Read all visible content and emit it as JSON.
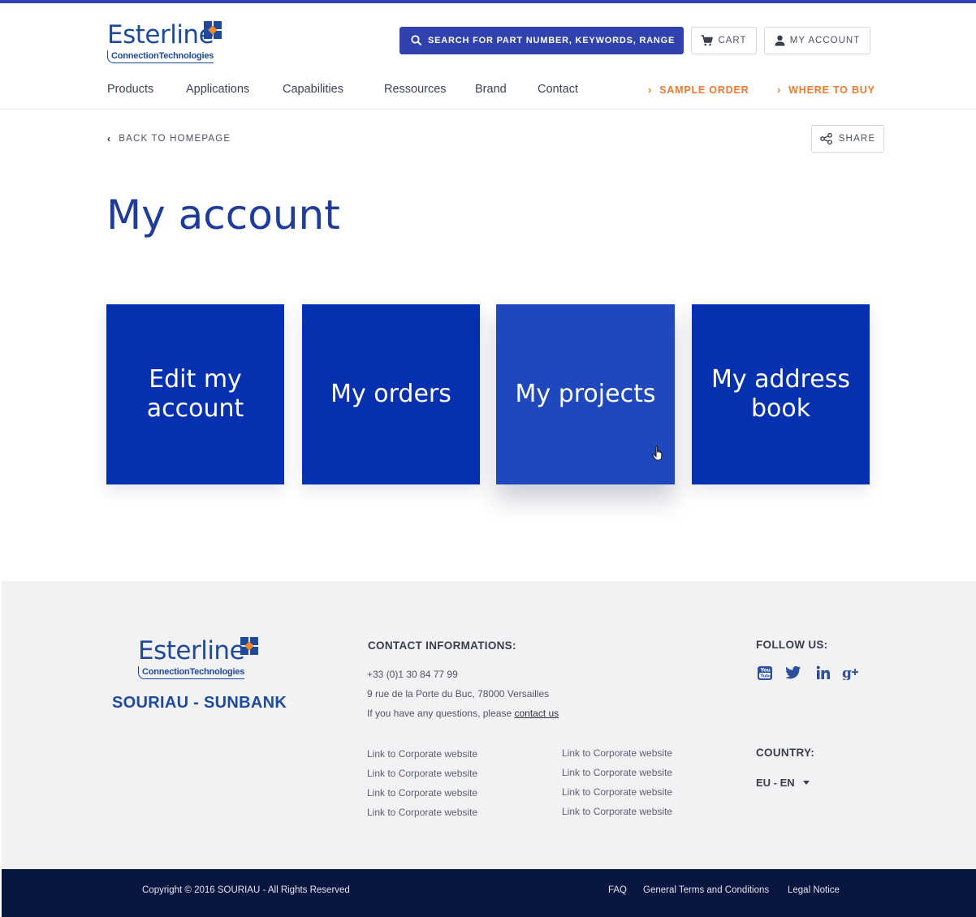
{
  "brand": {
    "logo_word": "Esterline",
    "logo_sub": "ConnectionTechnologies",
    "footer_brand": "SOURIAU - SUNBANK"
  },
  "header": {
    "search_label": "SEARCH FOR PART NUMBER, KEYWORDS, RANGE",
    "cart_label": "CART",
    "account_label": "MY ACCOUNT",
    "nav": [
      "Products",
      "Applications",
      "Capabilities",
      "Ressources",
      "Brand",
      "Contact"
    ],
    "sample_order": "SAMPLE ORDER",
    "where_to_buy": "WHERE TO BUY"
  },
  "subheader": {
    "back_label": "BACK TO HOMEPAGE",
    "share_label": "SHARE"
  },
  "main": {
    "title": "My account",
    "tiles": [
      "Edit my account",
      "My orders",
      "My projects",
      "My address book"
    ],
    "hovered_tile": "My projects"
  },
  "footer": {
    "contact_heading": "CONTACT INFORMATIONS:",
    "phone": "+33 (0)1 30 84 77 99",
    "address": "9 rue de la Porte du Buc, 78000 Versailles",
    "questions_prefix": "If you have any questions, please",
    "contact_link": "contact us",
    "links_col1": [
      "Link to Corporate website",
      "Link to Corporate website",
      "Link to Corporate website",
      "Link to Corporate website"
    ],
    "links_col2": [
      "Link to Corporate website",
      "Link to Corporate website",
      "Link to Corporate website",
      "Link to Corporate website"
    ],
    "follow_heading": "FOLLOW US:",
    "social": [
      "youtube-icon",
      "twitter-icon",
      "linkedin-icon",
      "google-plus-icon"
    ],
    "country_heading": "COUNTRY:",
    "country_value": "EU - EN"
  },
  "bottom": {
    "copyright": "Copyright © 2016 SOURIAU - All Rights Reserved",
    "faq": "FAQ",
    "terms": "General Terms and Conditions",
    "legal": "Legal Notice"
  },
  "colors": {
    "accent_blue": "#3042b0",
    "tile_blue": "#0530b0",
    "tile_hover": "#1f48bd",
    "orange": "#ef7a2f",
    "navy": "#081640"
  }
}
